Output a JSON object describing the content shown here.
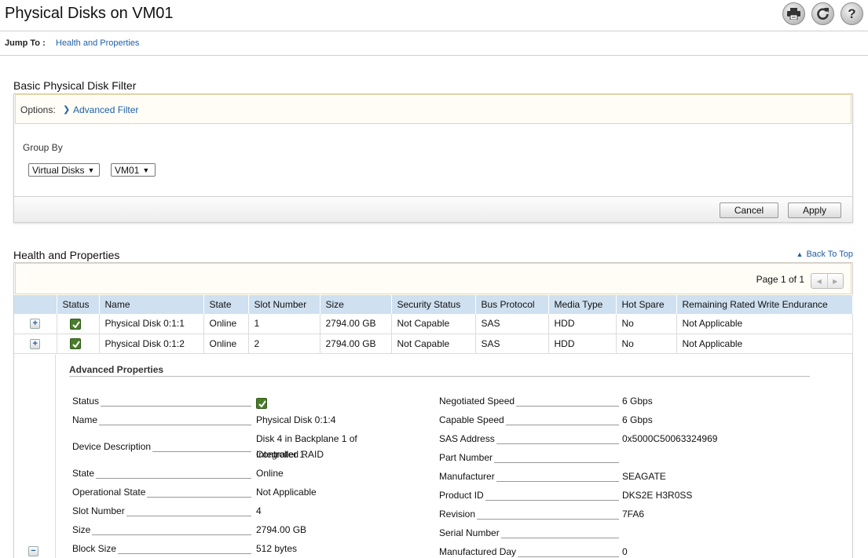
{
  "header": {
    "title": "Physical Disks on VM01",
    "jump_label": "Jump To :",
    "jump_link": "Health and Properties",
    "icons": [
      "print-icon",
      "refresh-icon",
      "help-icon"
    ]
  },
  "filter": {
    "title": "Basic Physical Disk Filter",
    "options_label": "Options:",
    "advanced_filter_link": "Advanced Filter",
    "group_by_label": "Group By",
    "group_by_value": "Virtual Disks",
    "target_value": "VM01",
    "cancel_label": "Cancel",
    "apply_label": "Apply"
  },
  "health": {
    "title": "Health and Properties",
    "back_to_top": "Back To Top",
    "page_text": "Page 1 of 1",
    "columns": [
      "Status",
      "Name",
      "State",
      "Slot Number",
      "Size",
      "Security Status",
      "Bus Protocol",
      "Media Type",
      "Hot Spare",
      "Remaining Rated Write Endurance"
    ],
    "rows": [
      {
        "name": "Physical Disk 0:1:1",
        "state": "Online",
        "slot": "1",
        "size": "2794.00 GB",
        "security": "Not Capable",
        "bus": "SAS",
        "media": "HDD",
        "hot_spare": "No",
        "endurance": "Not Applicable"
      },
      {
        "name": "Physical Disk 0:1:2",
        "state": "Online",
        "slot": "2",
        "size": "2794.00 GB",
        "security": "Not Capable",
        "bus": "SAS",
        "media": "HDD",
        "hot_spare": "No",
        "endurance": "Not Applicable"
      }
    ]
  },
  "advanced": {
    "title": "Advanced Properties",
    "left": [
      {
        "label": "Status",
        "value": ""
      },
      {
        "label": "Name",
        "value": "Physical Disk 0:1:4"
      },
      {
        "label": "Device Description",
        "value": "Disk 4 in Backplane 1 of Integrated RAID",
        "value2": "Controller 1"
      },
      {
        "label": "State",
        "value": "Online"
      },
      {
        "label": "Operational State",
        "value": "Not Applicable"
      },
      {
        "label": "Slot Number",
        "value": "4"
      },
      {
        "label": "Size",
        "value": "2794.00 GB"
      },
      {
        "label": "Block Size",
        "value": "512 bytes"
      }
    ],
    "right": [
      {
        "label": "Negotiated Speed",
        "value": "6 Gbps"
      },
      {
        "label": "Capable Speed",
        "value": "6 Gbps"
      },
      {
        "label": "SAS Address",
        "value": "0x5000C50063324969"
      },
      {
        "label": "Part Number",
        "value": ""
      },
      {
        "label": "Manufacturer",
        "value": "SEAGATE"
      },
      {
        "label": "Product ID",
        "value": "DKS2E H3R0SS"
      },
      {
        "label": "Revision",
        "value": "7FA6"
      },
      {
        "label": "Serial Number",
        "value": ""
      },
      {
        "label": "Manufactured Day",
        "value": "0"
      }
    ]
  }
}
